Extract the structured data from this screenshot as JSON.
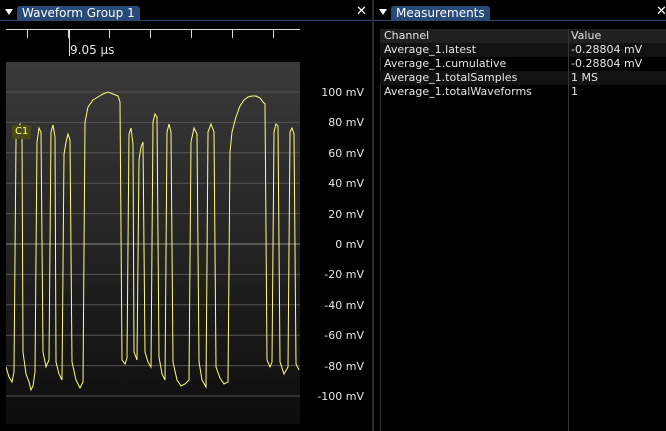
{
  "waveform_panel": {
    "title": "Waveform Group 1",
    "close": "✕",
    "cursor_time": "9.05 µs",
    "channel_label": "C1",
    "y_labels": [
      "100 mV",
      "80 mV",
      "60 mV",
      "40 mV",
      "20 mV",
      "0 mV",
      "-20 mV",
      "-40 mV",
      "-60 mV",
      "-80 mV",
      "-100 mV"
    ],
    "trace_color": "#ffff80"
  },
  "measurements_panel": {
    "title": "Measurements",
    "close": "✕",
    "headers": {
      "channel": "Channel",
      "value": "Value"
    },
    "rows": [
      {
        "channel": "Average_1.latest",
        "value": "-0.28804 mV"
      },
      {
        "channel": "Average_1.cumulative",
        "value": "-0.28804 mV"
      },
      {
        "channel": "Average_1.totalSamples",
        "value": "1 MS"
      },
      {
        "channel": "Average_1.totalWaveforms",
        "value": "1"
      }
    ]
  },
  "colors": {
    "tab_active": "#274a79",
    "trace": "#ffff80"
  }
}
